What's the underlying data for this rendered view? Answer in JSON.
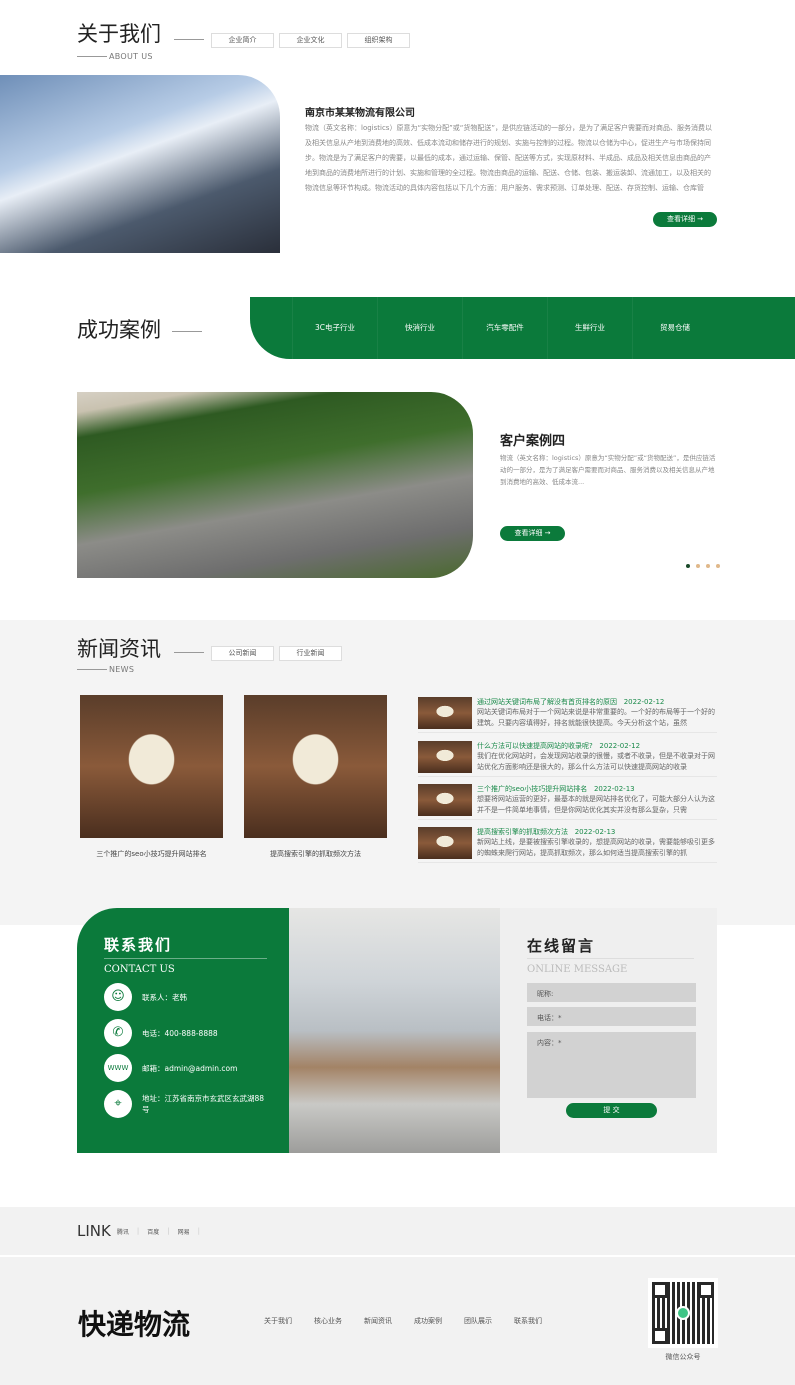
{
  "about": {
    "title": "关于我们",
    "subtitle": "ABOUT US",
    "tabs": [
      "企业简介",
      "企业文化",
      "组织架构"
    ],
    "company": "南京市某某物流有限公司",
    "text": "物流（英文名称：logistics）原意为“实物分配”或“货物配送”，是供应链活动的一部分，是为了满足客户需要而对商品、服务消费以及相关信息从产地到消费地的高效、低成本流动和储存进行的规划、实施与控制的过程。物流以仓储为中心，促进生产与市场保持同步。物流是为了满足客户的需要，以最低的成本，通过运输、保管、配送等方式，实现原材料、半成品、成品及相关信息由商品的产地到商品的消费地所进行的计划、实施和管理的全过程。物流由商品的运输、配送、仓储、包装、搬运装卸、流通加工，以及相关的物流信息等环节构成。物流活动的具体内容包括以下几个方面：用户服务、需求预测、订单处理、配送、存货控制、运输、仓库管理、工厂...",
    "more": "查看详细 →"
  },
  "cases": {
    "title": "成功案例",
    "categories": [
      "3C电子行业",
      "快消行业",
      "汽车零配件",
      "生鲜行业",
      "贸易仓储"
    ],
    "case_title": "客户案例四",
    "case_text": "物流（英文名称：logistics）原意为“实物分配”或“货物配送”，是供应链活动的一部分，是为了满足客户需要而对商品、服务消费以及相关信息从产地到消费地的高效、低成本流...",
    "more": "查看详细 →",
    "slide_index": 1,
    "slide_count": 4
  },
  "news": {
    "title": "新闻资讯",
    "subtitle": "NEWS",
    "tabs": [
      "公司新闻",
      "行业新闻"
    ],
    "cards": [
      {
        "caption": "三个推广的seo小技巧提升网站排名"
      },
      {
        "caption": "提高搜索引擎的抓取频次方法"
      }
    ],
    "items": [
      {
        "title": "通过网站关键词布局了解没有首页排名的原因",
        "date": "2022-02-12",
        "desc": "网站关键词布局对于一个网站来说是非常重要的。一个好的布局等于一个好的建筑。只要内容填得好，排名就能很快提高。今天分析这个站，虽然"
      },
      {
        "title": "什么方法可以快速提高网站的收录呢?",
        "date": "2022-02-12",
        "desc": "我们在优化网站时，会发现网站收录的很慢，或者不收录，但是不收录对于网站优化方面影响还是很大的，那么什么方法可以快速提高网站的收录"
      },
      {
        "title": "三个推广的seo小技巧提升网站排名",
        "date": "2022-02-13",
        "desc": "想要将网站运营的更好，最基本的就是网站排名优化了，可能大部分人认为这并不是一件简单地事情，但是你网站优化其实并没有那么复杂，只需"
      },
      {
        "title": "提高搜索引擎的抓取频次方法",
        "date": "2022-02-13",
        "desc": "新网站上线，是要被搜索引擎收录的，想提高网站的收录，需要能够吸引更多的蜘蛛来爬行网站，提高抓取频次，那么如何适当提高搜索引擎的抓"
      }
    ]
  },
  "contact": {
    "title": "联系我们",
    "subtitle": "CONTACT US",
    "person": "联系人：老韩",
    "phone": "电话：400-888-8888",
    "email": "邮箱：admin@admin.com",
    "address": "地址：江苏省南京市玄武区玄武湖88号"
  },
  "message": {
    "title": "在线留言",
    "subtitle": "ONLINE MESSAGE",
    "name_placeholder": "昵称:",
    "phone_placeholder": "电话：*",
    "content_placeholder": "内容：*",
    "submit": "提 交"
  },
  "links": {
    "title": "LINK",
    "items": [
      "腾讯",
      "百度",
      "网易"
    ]
  },
  "footer": {
    "logo": "快递物流",
    "nav": [
      "关于我们",
      "核心业务",
      "新闻资讯",
      "成功案例",
      "团队展示",
      "联系我们"
    ],
    "qr_label": "微信公众号"
  },
  "colors": {
    "brand": "#0b7a3b"
  }
}
